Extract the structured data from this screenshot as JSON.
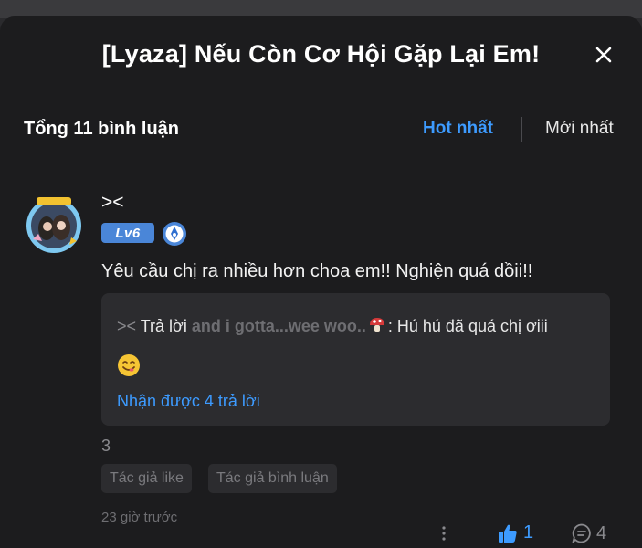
{
  "dialog": {
    "title": "[Lyaza] Nếu Còn Cơ Hội Gặp Lại Em!"
  },
  "comments_header": {
    "total": "Tổng 11 bình luận",
    "sort_hot": "Hot nhất",
    "sort_new": "Mới nhất"
  },
  "comment": {
    "username": "><",
    "level": "Lv6",
    "text": "Yêu cầu chị ra nhiều hơn choa em!! Nghiện quá dồii!!",
    "reply": {
      "author": "><",
      "verb": "Trả lời",
      "target": "and i gotta...wee woo..",
      "text": ": Hú hú đã quá chị ơiii"
    },
    "more_replies": "Nhận được 4 trả lời",
    "stray_number": "3",
    "tags": [
      "Tác giả like",
      "Tác giả bình luận"
    ],
    "timestamp": "23 giờ trước",
    "likes": "1",
    "replies": "4"
  },
  "colors": {
    "accent": "#3d9bff",
    "background": "#1c1c1e",
    "level_badge": "#4a86d8"
  },
  "icons": [
    "close-icon",
    "vip-badge-icon",
    "mushroom-icon",
    "smile-emoji-icon",
    "more-vertical-icon",
    "thumbs-up-icon",
    "comment-bubble-icon"
  ]
}
